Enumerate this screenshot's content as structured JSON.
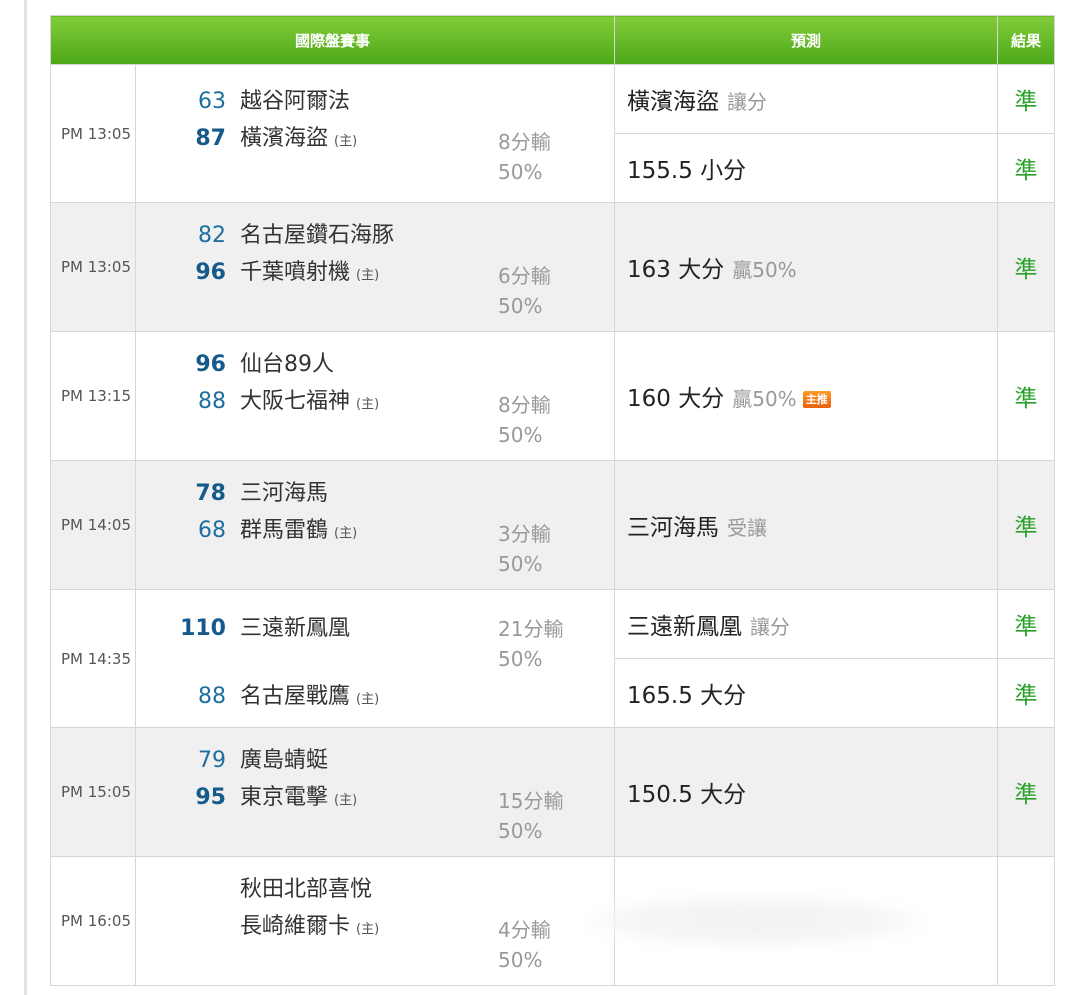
{
  "header": {
    "games": "國際盤賽事",
    "prediction": "預測",
    "result": "結果"
  },
  "home_marker": "(主)",
  "games": [
    {
      "time": "PM 13:05",
      "away": {
        "score": "63",
        "name": "越谷阿爾法"
      },
      "home": {
        "score": "87",
        "name": "橫濱海盜"
      },
      "spread": "8分輸",
      "pct": "50%",
      "pred1": {
        "main": "橫濱海盜",
        "extra": "讓分",
        "result": "準"
      },
      "pred2": {
        "main": "155.5 小分",
        "result": "準"
      }
    },
    {
      "time": "PM 13:05",
      "away": {
        "score": "82",
        "name": "名古屋鑽石海豚"
      },
      "home": {
        "score": "96",
        "name": "千葉噴射機"
      },
      "spread": "6分輸",
      "pct": "50%",
      "pred1": {
        "main": "163 大分",
        "extra": "贏50%",
        "result": "準"
      }
    },
    {
      "time": "PM 13:15",
      "away": {
        "score": "96",
        "name": "仙台89人"
      },
      "home": {
        "score": "88",
        "name": "大阪七福神"
      },
      "spread": "8分輸",
      "pct": "50%",
      "pred1": {
        "main": "160 大分",
        "extra": "贏50%",
        "badge": "主推",
        "result": "準"
      }
    },
    {
      "time": "PM 14:05",
      "away": {
        "score": "78",
        "name": "三河海馬"
      },
      "home": {
        "score": "68",
        "name": "群馬雷鶴"
      },
      "spread": "3分輸",
      "pct": "50%",
      "pred1": {
        "main": "三河海馬",
        "extra": "受讓",
        "result": "準"
      }
    },
    {
      "time": "PM 14:35",
      "away": {
        "score": "110",
        "name": "三遠新鳳凰"
      },
      "home": {
        "score": "88",
        "name": "名古屋戰鷹"
      },
      "spread": "21分輸",
      "pct": "50%",
      "pred1": {
        "main": "三遠新鳳凰",
        "extra": "讓分",
        "result": "準"
      },
      "pred2": {
        "main": "165.5 大分",
        "result": "準"
      }
    },
    {
      "time": "PM 15:05",
      "away": {
        "score": "79",
        "name": "廣島蜻蜓"
      },
      "home": {
        "score": "95",
        "name": "東京電擊"
      },
      "spread": "15分輸",
      "pct": "50%",
      "pred1": {
        "main": "150.5 大分",
        "result": "準"
      }
    },
    {
      "time": "PM 16:05",
      "away": {
        "score": "",
        "name": "秋田北部喜悅"
      },
      "home": {
        "score": "",
        "name": "長崎維爾卡"
      },
      "spread": "4分輸",
      "pct": "50%"
    }
  ],
  "colors": {
    "header_green": "#5cb526",
    "score_blue": "#1e6fa0",
    "result_green": "#2aa02a",
    "muted": "#999999"
  }
}
